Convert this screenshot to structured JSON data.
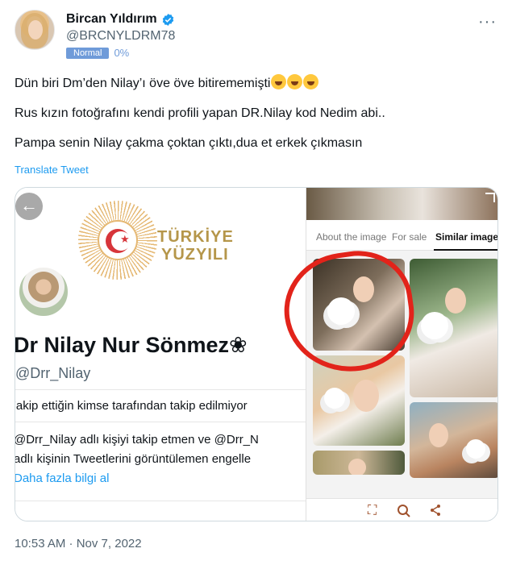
{
  "author": {
    "display_name": "Bircan Yıldırım",
    "handle": "@BRCNYLDRM78",
    "badge": "Normal",
    "percent": "0%",
    "verified_color": "#1d9bf0"
  },
  "tweet": {
    "line1": "Dün biri Dm’den Nilay’ı öve öve bitirememişti",
    "line2": "Rus kızın fotoğrafını kendi profili yapan DR.Nilay kod Nedim abi..",
    "line3": "Pampa senin Nilay çakma çoktan çıktı,dua et erkek çıkmasın",
    "translate": "Translate Tweet",
    "more_icon": "more-icon",
    "timestamp": "10:53 AM · Nov 7, 2022"
  },
  "media": {
    "profile": {
      "logo_line1": "TÜRKİYE",
      "logo_line2": "YÜZYILI",
      "name": "Dr Nilay Nur Sönmez❀",
      "handle": "@Drr_Nilay",
      "blocked_text": "'akip ettiğin kimse tarafından takip edilmiyor",
      "info_line1": "@Drr_Nilay adlı kişiyi takip etmen ve @Drr_N",
      "info_line2": "adlı kişinin Tweetlerini görüntülemen engelle",
      "link": "Daha fazla bilgi al"
    },
    "lens": {
      "tabs": [
        "About the image",
        "For sale",
        "Similar images"
      ],
      "active_tab": "Similar images"
    }
  }
}
